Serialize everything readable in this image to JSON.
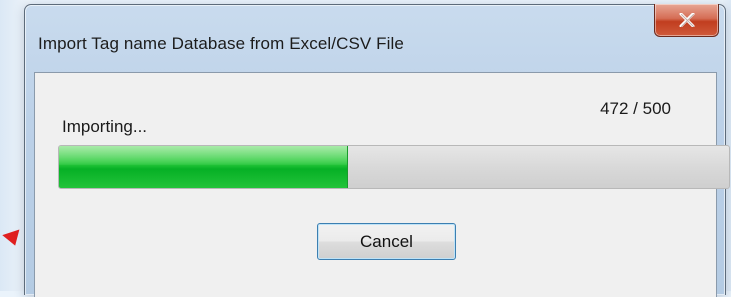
{
  "window": {
    "title": "Import Tag name Database from Excel/CSV File",
    "close_icon": "close-icon"
  },
  "progress": {
    "status_text": "Importing...",
    "count_text": "472 / 500",
    "fill_fraction": 0.43,
    "fill_color": "#06b025"
  },
  "buttons": {
    "cancel_label": "Cancel"
  },
  "colors": {
    "close_button": "#c13d1f",
    "arrow_accent": "#e02020"
  }
}
